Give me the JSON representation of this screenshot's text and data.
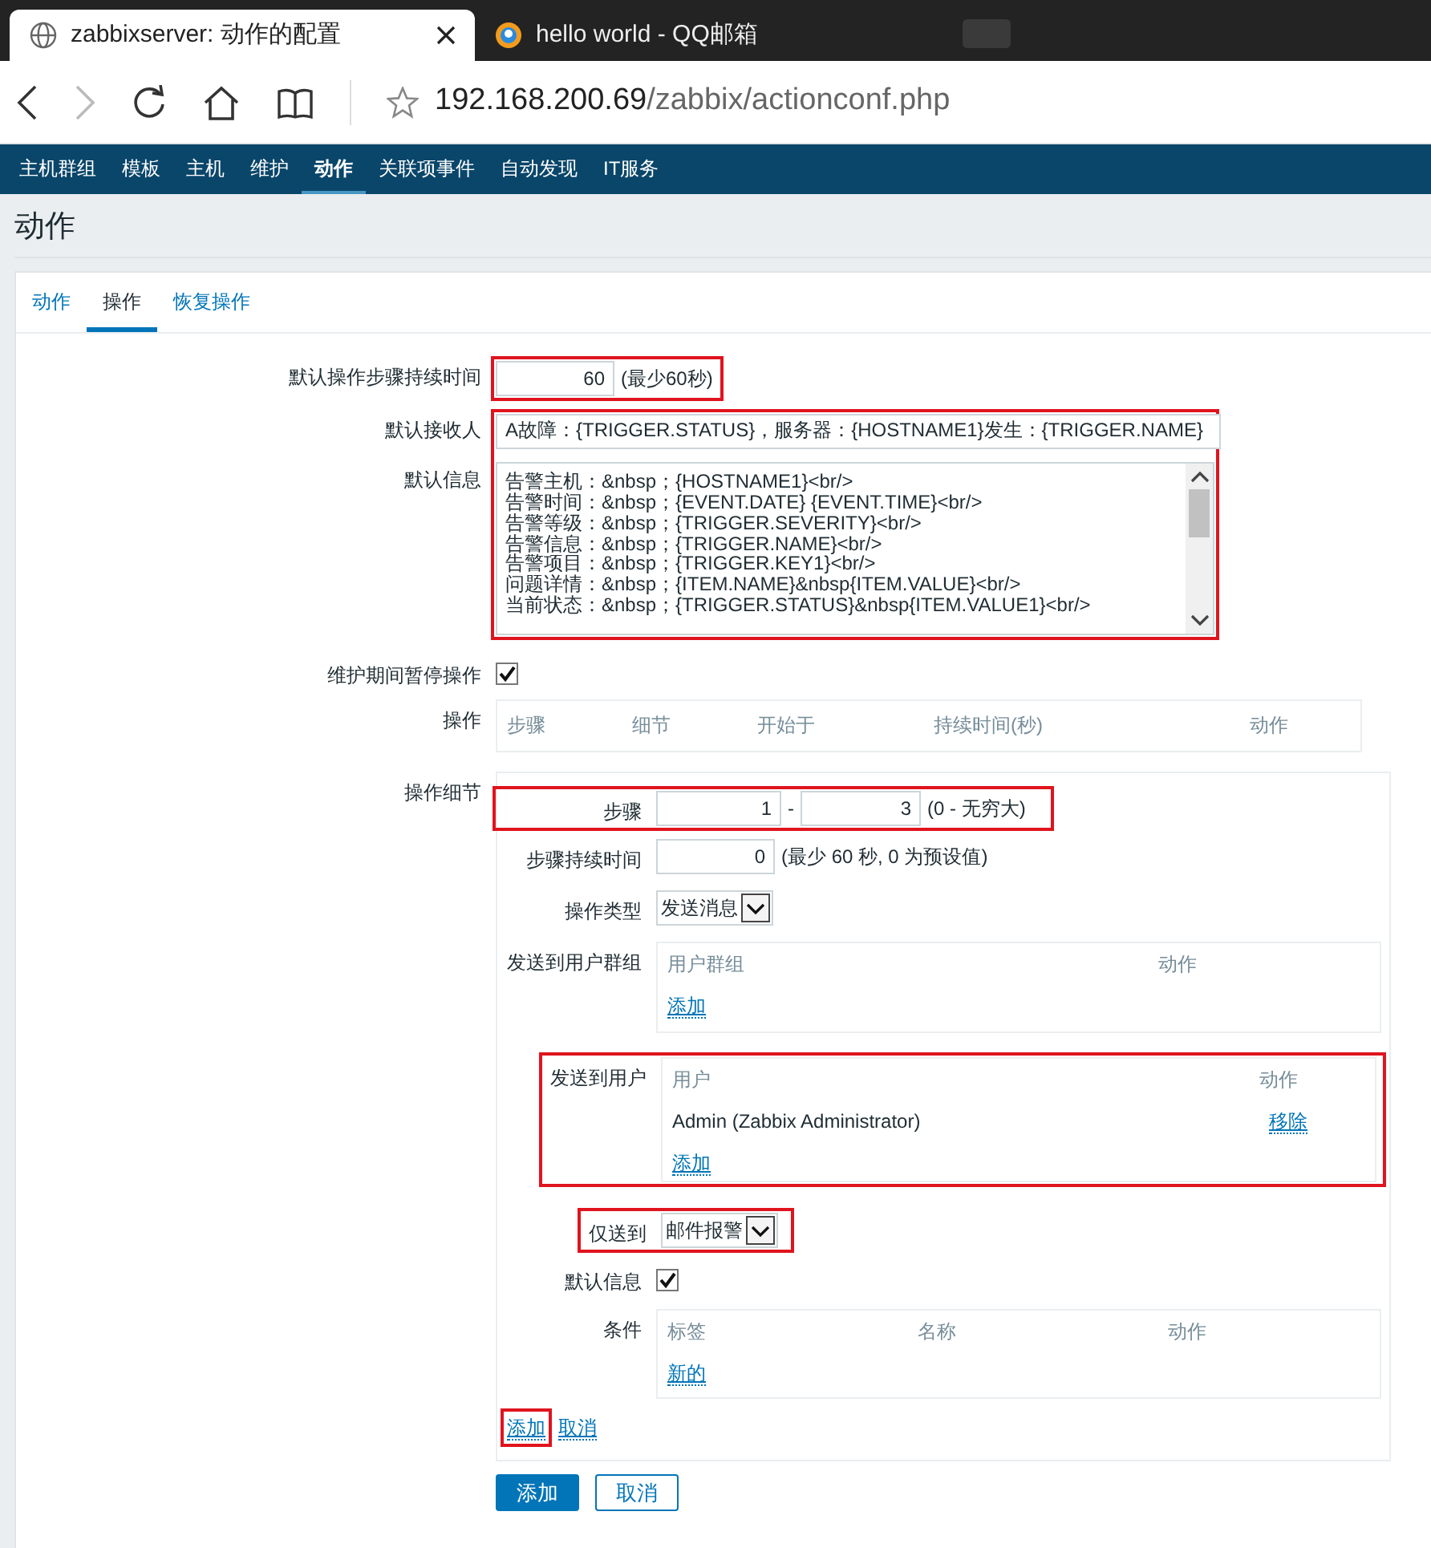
{
  "browser": {
    "tabs": [
      {
        "title": "zabbixserver: 动作的配置",
        "selected": true
      },
      {
        "title": "hello world - QQ邮箱",
        "selected": false
      }
    ],
    "address": {
      "host": "192.168.200.69",
      "path": "/zabbix/actionconf.php"
    }
  },
  "nav": [
    {
      "label": "主机群组",
      "selected": false
    },
    {
      "label": "模板",
      "selected": false
    },
    {
      "label": "主机",
      "selected": false
    },
    {
      "label": "维护",
      "selected": false
    },
    {
      "label": "动作",
      "selected": true
    },
    {
      "label": "关联项事件",
      "selected": false
    },
    {
      "label": "自动发现",
      "selected": false
    },
    {
      "label": "IT服务",
      "selected": false
    }
  ],
  "page_title": "动作",
  "form_tabs": [
    {
      "label": "动作",
      "selected": false
    },
    {
      "label": "操作",
      "selected": true
    },
    {
      "label": "恢复操作",
      "selected": false
    }
  ],
  "step_duration": {
    "label": "默认操作步骤持续时间",
    "value": "60",
    "hint": "(最少60秒)",
    "highlighted": true
  },
  "message_group": {
    "highlighted": true,
    "subject": {
      "label": "默认接收人",
      "value": "A故障：{TRIGGER.STATUS}，服务器：{HOSTNAME1}发生：{TRIGGER.NAME}"
    },
    "message": {
      "label": "默认信息",
      "lines": [
        "告警主机：&nbsp；{HOSTNAME1}<br/>",
        "告警时间：&nbsp；{EVENT.DATE} {EVENT.TIME}<br/>",
        "告警等级：&nbsp；{TRIGGER.SEVERITY}<br/>",
        "告警信息：&nbsp；{TRIGGER.NAME}<br/>",
        "告警项目：&nbsp；{TRIGGER.KEY1}<br/>",
        "问题详情：&nbsp；{ITEM.NAME}&nbsp{ITEM.VALUE}<br/>",
        "当前状态：&nbsp；{TRIGGER.STATUS}&nbsp{ITEM.VALUE1}<br/>"
      ]
    }
  },
  "pause": {
    "label": "维护期间暂停操作",
    "checked": true
  },
  "operations": {
    "label": "操作",
    "columns": [
      "步骤",
      "细节",
      "开始于",
      "持续时间(秒)",
      "动作"
    ]
  },
  "details": {
    "label": "操作细节",
    "steps": {
      "label": "步骤",
      "from": "1",
      "separator": "-",
      "to": "3",
      "hint": "(0 - 无穷大)",
      "highlighted": true
    },
    "step_duration": {
      "label": "步骤持续时间",
      "value": "0",
      "hint": "(最少 60 秒, 0 为预设值)"
    },
    "operation_type": {
      "label": "操作类型",
      "value": "发送消息"
    },
    "user_groups": {
      "label": "发送到用户群组",
      "columns": [
        "用户群组",
        "动作"
      ],
      "add_link": "添加",
      "highlighted": false
    },
    "users": {
      "label": "发送到用户",
      "columns": [
        "用户",
        "动作"
      ],
      "rows": [
        {
          "name": "Admin (Zabbix Administrator)",
          "action": "移除"
        }
      ],
      "add_link": "添加",
      "highlighted": true
    },
    "send_only_to": {
      "label": "仅送到",
      "value": "邮件报警",
      "highlighted": true
    },
    "default_message": {
      "label": "默认信息",
      "checked": true
    },
    "conditions": {
      "label": "条件",
      "columns": [
        "标签",
        "名称",
        "动作"
      ],
      "new_link": "新的"
    },
    "links": [
      {
        "text": "添加",
        "highlighted": true
      },
      {
        "text": "取消",
        "highlighted": false
      }
    ]
  },
  "buttons": [
    {
      "text": "添加",
      "primary": true
    },
    {
      "text": "取消",
      "primary": false
    }
  ]
}
